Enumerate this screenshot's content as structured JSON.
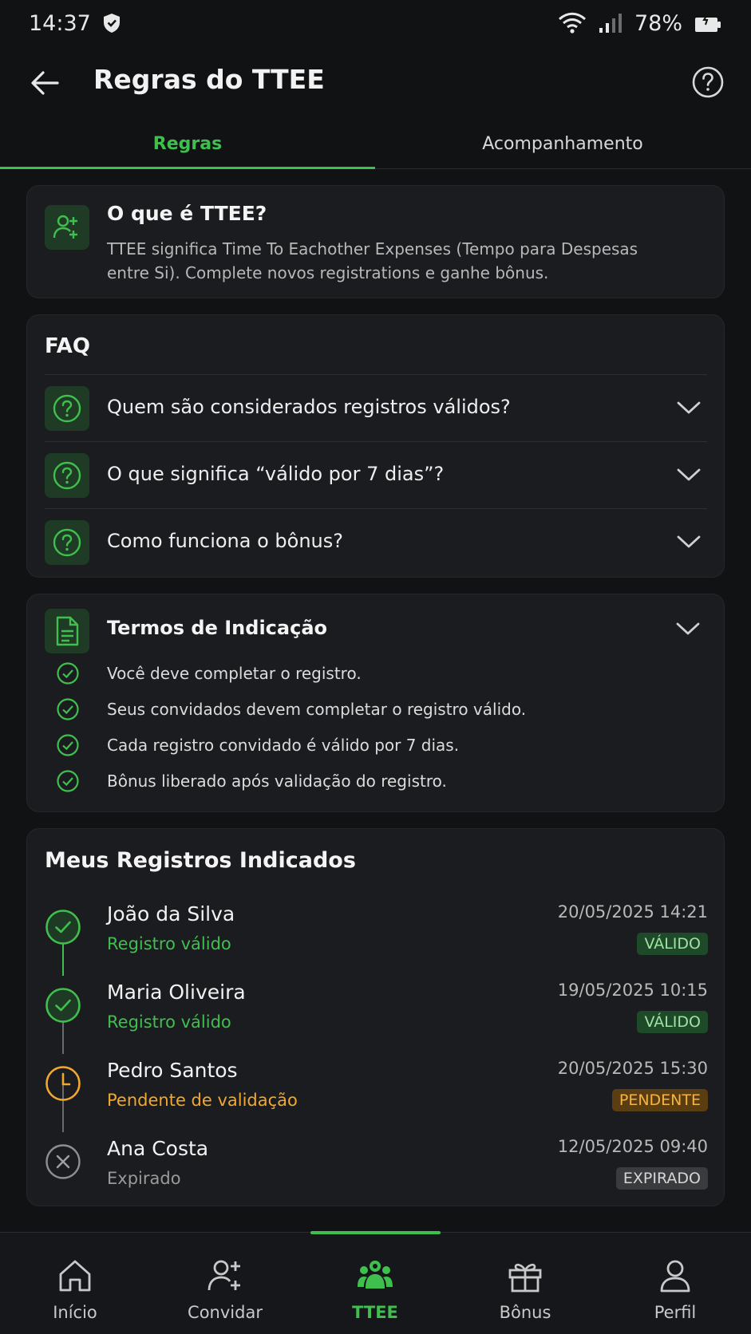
{
  "status_bar": {
    "time": "14:37",
    "battery": "78%"
  },
  "header": {
    "title": "Regras do TTEE"
  },
  "tabs": [
    {
      "label": "Regras",
      "active": true
    },
    {
      "label": "Acompanhamento",
      "active": false
    }
  ],
  "intro": {
    "title": "O que é TTEE?",
    "description": "TTEE significa Time To Eachother Expenses (Tempo para Despesas entre Si). Complete novos registrations e ganhe bônus."
  },
  "faq": {
    "title": "FAQ",
    "items": [
      {
        "question": "Quem são considerados registros válidos?"
      },
      {
        "question": "O que significa “válido por 7 dias”?"
      },
      {
        "question": "Como funciona o bônus?"
      }
    ]
  },
  "terms": {
    "title": "Termos de Indicação",
    "items": [
      "Você deve completar o registro.",
      "Seus convidados devem completar o registro válido.",
      "Cada registro convidado é válido por 7 dias.",
      "Bônus liberado após validação do registro."
    ]
  },
  "registrations": {
    "title": "Meus Registros Indicados",
    "items": [
      {
        "name": "João da Silva",
        "status_text": "Registro válido",
        "datetime": "20/05/2025 14:21",
        "badge": "VÁLIDO",
        "state": "valid"
      },
      {
        "name": "Maria Oliveira",
        "status_text": "Registro válido",
        "datetime": "19/05/2025 10:15",
        "badge": "VÁLIDO",
        "state": "valid"
      },
      {
        "name": "Pedro Santos",
        "status_text": "Pendente de validação",
        "datetime": "20/05/2025 15:30",
        "badge": "PENDENTE",
        "state": "pending"
      },
      {
        "name": "Ana Costa",
        "status_text": "Expirado",
        "datetime": "12/05/2025 09:40",
        "badge": "EXPIRADO",
        "state": "expired"
      }
    ]
  },
  "bottom_nav": {
    "items": [
      {
        "label": "Início",
        "icon": "home-icon"
      },
      {
        "label": "Convidar",
        "icon": "add-user-icon"
      },
      {
        "label": "TTEE",
        "icon": "group-icon",
        "active": true
      },
      {
        "label": "Bônus",
        "icon": "gift-icon"
      },
      {
        "label": "Perfil",
        "icon": "profile-icon"
      }
    ]
  },
  "colors": {
    "accent": "#3fbf4d",
    "pending": "#f0a830",
    "expired": "#9a9a9a",
    "background": "#111214",
    "card": "#1b1c1f"
  }
}
